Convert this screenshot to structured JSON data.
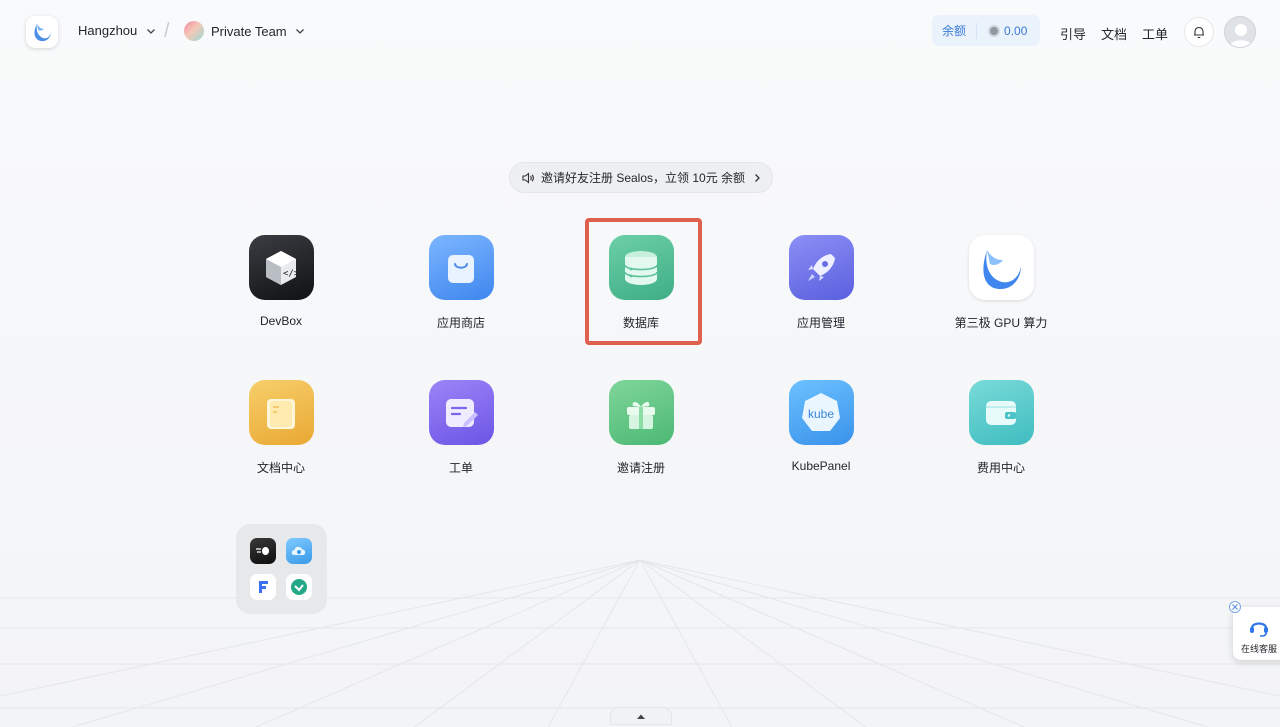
{
  "header": {
    "region": "Hangzhou",
    "team": "Private Team",
    "balance_label": "余额",
    "balance_value": "0.00",
    "nav": [
      "引导",
      "文档",
      "工单"
    ]
  },
  "banner": {
    "text": "邀请好友注册 Sealos，立领 10元 余额"
  },
  "apps": [
    {
      "label": "DevBox",
      "icon": "devbox-icon"
    },
    {
      "label": "应用商店",
      "icon": "app-store-bag-icon"
    },
    {
      "label": "数据库",
      "icon": "database-icon"
    },
    {
      "label": "应用管理",
      "icon": "rocket-icon"
    },
    {
      "label": "第三极 GPU 算力",
      "icon": "sealos-logo-icon"
    },
    {
      "label": "文档中心",
      "icon": "notebook-icon"
    },
    {
      "label": "工单",
      "icon": "ticket-edit-icon"
    },
    {
      "label": "邀请注册",
      "icon": "gift-icon"
    },
    {
      "label": "KubePanel",
      "icon": "kube-icon"
    },
    {
      "label": "费用中心",
      "icon": "wallet-icon"
    }
  ],
  "kube_text": "kube",
  "folder_apps": [
    "speed-icon",
    "cloud-icon",
    "f-logo-icon",
    "leaf-chat-icon"
  ],
  "support": {
    "label": "在线客服"
  },
  "colors": {
    "accent": "#3b7bd6",
    "highlight": "#e0604f"
  }
}
